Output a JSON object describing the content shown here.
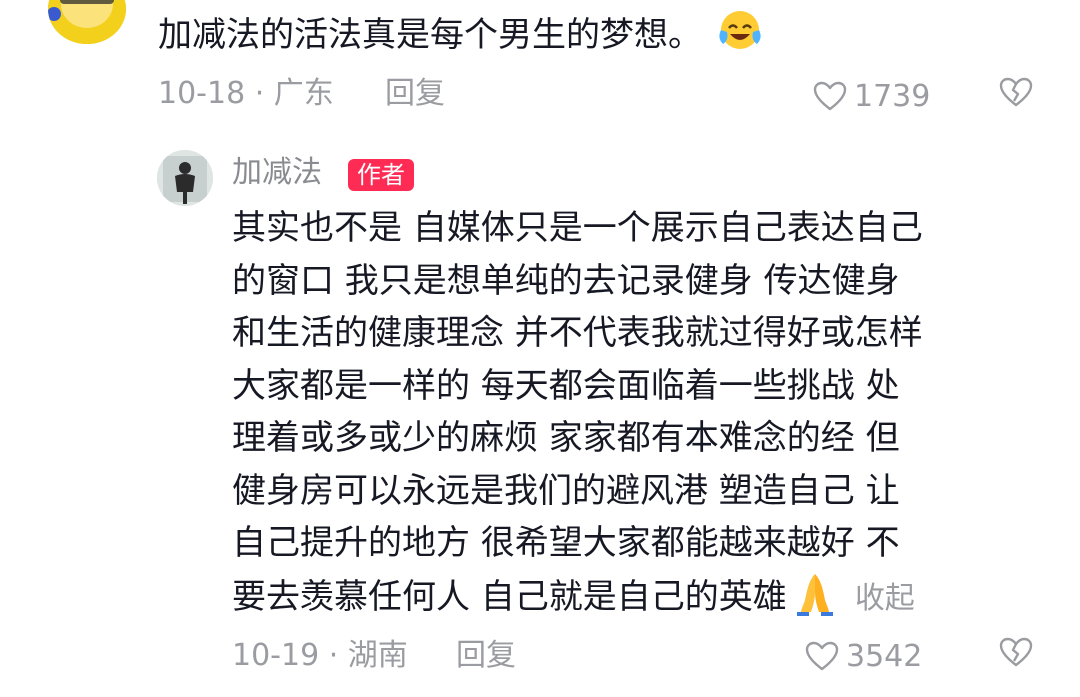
{
  "top_comment": {
    "text": "加减法的活法真是每个男生的梦想。",
    "emoji": "laughing-crying-emoji",
    "meta": "10-18 · 广东",
    "reply_label": "回复",
    "like_count": "1739",
    "icons": {
      "like": "heart-outline-icon",
      "dislike": "broken-heart-icon"
    }
  },
  "reply": {
    "author": "加减法",
    "badge": "作者",
    "body": "其实也不是 自媒体只是一个展示自己表达自己\n的窗口 我只是想单纯的去记录健身 传达健身\n和生活的健康理念 并不代表我就过得好或怎样\n大家都是一样的 每天都会面临着一些挑战 处\n理着或多或少的麻烦 家家都有本难念的经 但\n健身房可以永远是我们的避风港 塑造自己 让\n自己提升的地方 很希望大家都能越来越好 不\n要去羡慕任何人 自己就是自己的英雄",
    "emoji": "folded-hands-emoji",
    "collapse_label": "收起",
    "meta": "10-19 · 湖南",
    "reply_label": "回复",
    "like_count": "3542"
  },
  "colors": {
    "badge": "#fe2c55",
    "meta": "#9b9ca1",
    "text": "#161823"
  }
}
